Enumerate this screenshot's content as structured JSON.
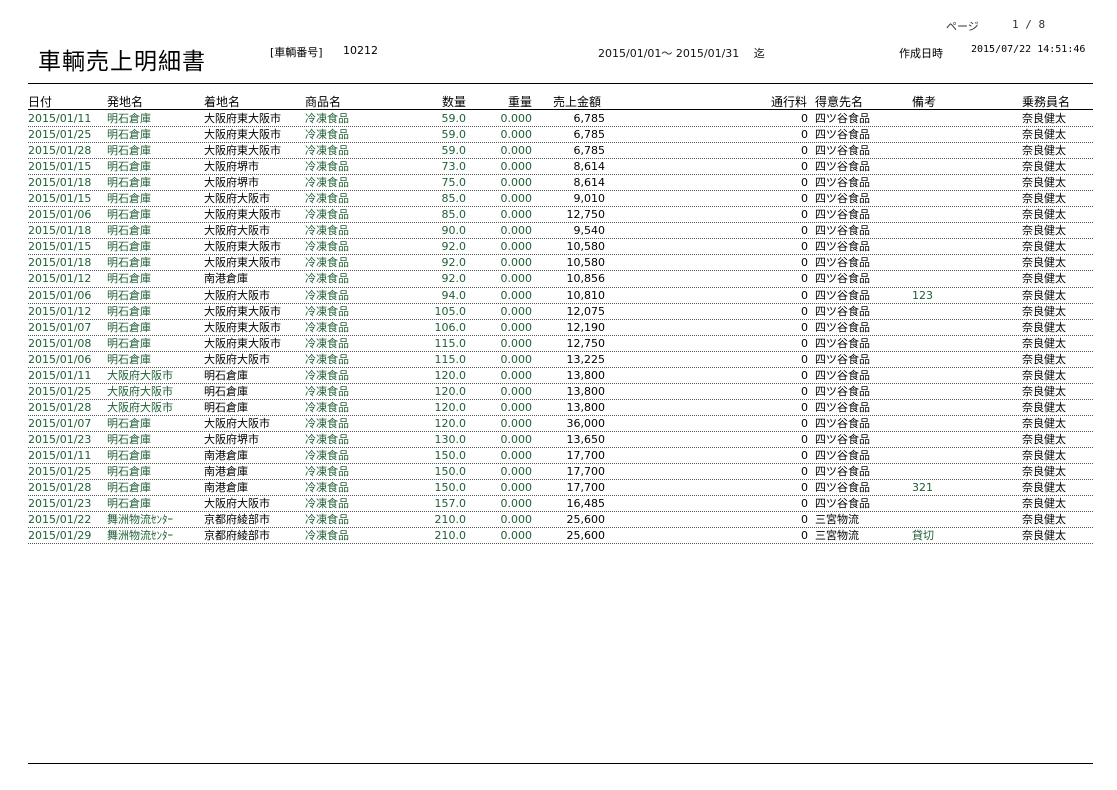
{
  "header": {
    "title": "車輌売上明細書",
    "vehicle_label": "[車輌番号]",
    "vehicle_no": "10212",
    "page_label": "ページ",
    "page_value": "1 / 8",
    "period": "2015/01/01～ 2015/01/31　 迄",
    "created_label": "作成日時",
    "created_value": "2015/07/22  14:51:46"
  },
  "columns": {
    "date": "日付",
    "origin": "発地名",
    "dest": "着地名",
    "product": "商品名",
    "qty": "数量",
    "weight": "重量",
    "sales": "売上金額",
    "toll": "通行料",
    "customer": "得意先名",
    "remarks": "備考",
    "driver": "乗務員名"
  },
  "rows": [
    {
      "date": "2015/01/11",
      "origin": "明石倉庫",
      "dest": "大阪府東大阪市",
      "product": "冷凍食品",
      "qty": "59.0",
      "weight": "0.000",
      "sales": "6,785",
      "toll": "0",
      "customer": "四ツ谷食品",
      "remarks": "",
      "driver": "奈良健太"
    },
    {
      "date": "2015/01/25",
      "origin": "明石倉庫",
      "dest": "大阪府東大阪市",
      "product": "冷凍食品",
      "qty": "59.0",
      "weight": "0.000",
      "sales": "6,785",
      "toll": "0",
      "customer": "四ツ谷食品",
      "remarks": "",
      "driver": "奈良健太"
    },
    {
      "date": "2015/01/28",
      "origin": "明石倉庫",
      "dest": "大阪府東大阪市",
      "product": "冷凍食品",
      "qty": "59.0",
      "weight": "0.000",
      "sales": "6,785",
      "toll": "0",
      "customer": "四ツ谷食品",
      "remarks": "",
      "driver": "奈良健太"
    },
    {
      "date": "2015/01/15",
      "origin": "明石倉庫",
      "dest": "大阪府堺市",
      "product": "冷凍食品",
      "qty": "73.0",
      "weight": "0.000",
      "sales": "8,614",
      "toll": "0",
      "customer": "四ツ谷食品",
      "remarks": "",
      "driver": "奈良健太"
    },
    {
      "date": "2015/01/18",
      "origin": "明石倉庫",
      "dest": "大阪府堺市",
      "product": "冷凍食品",
      "qty": "75.0",
      "weight": "0.000",
      "sales": "8,614",
      "toll": "0",
      "customer": "四ツ谷食品",
      "remarks": "",
      "driver": "奈良健太"
    },
    {
      "date": "2015/01/15",
      "origin": "明石倉庫",
      "dest": "大阪府大阪市",
      "product": "冷凍食品",
      "qty": "85.0",
      "weight": "0.000",
      "sales": "9,010",
      "toll": "0",
      "customer": "四ツ谷食品",
      "remarks": "",
      "driver": "奈良健太"
    },
    {
      "date": "2015/01/06",
      "origin": "明石倉庫",
      "dest": "大阪府東大阪市",
      "product": "冷凍食品",
      "qty": "85.0",
      "weight": "0.000",
      "sales": "12,750",
      "toll": "0",
      "customer": "四ツ谷食品",
      "remarks": "",
      "driver": "奈良健太"
    },
    {
      "date": "2015/01/18",
      "origin": "明石倉庫",
      "dest": "大阪府大阪市",
      "product": "冷凍食品",
      "qty": "90.0",
      "weight": "0.000",
      "sales": "9,540",
      "toll": "0",
      "customer": "四ツ谷食品",
      "remarks": "",
      "driver": "奈良健太"
    },
    {
      "date": "2015/01/15",
      "origin": "明石倉庫",
      "dest": "大阪府東大阪市",
      "product": "冷凍食品",
      "qty": "92.0",
      "weight": "0.000",
      "sales": "10,580",
      "toll": "0",
      "customer": "四ツ谷食品",
      "remarks": "",
      "driver": "奈良健太"
    },
    {
      "date": "2015/01/18",
      "origin": "明石倉庫",
      "dest": "大阪府東大阪市",
      "product": "冷凍食品",
      "qty": "92.0",
      "weight": "0.000",
      "sales": "10,580",
      "toll": "0",
      "customer": "四ツ谷食品",
      "remarks": "",
      "driver": "奈良健太"
    },
    {
      "date": "2015/01/12",
      "origin": "明石倉庫",
      "dest": "南港倉庫",
      "product": "冷凍食品",
      "qty": "92.0",
      "weight": "0.000",
      "sales": "10,856",
      "toll": "0",
      "customer": "四ツ谷食品",
      "remarks": "",
      "driver": "奈良健太"
    },
    {
      "date": "2015/01/06",
      "origin": "明石倉庫",
      "dest": "大阪府大阪市",
      "product": "冷凍食品",
      "qty": "94.0",
      "weight": "0.000",
      "sales": "10,810",
      "toll": "0",
      "customer": "四ツ谷食品",
      "remarks": "123",
      "driver": "奈良健太"
    },
    {
      "date": "2015/01/12",
      "origin": "明石倉庫",
      "dest": "大阪府東大阪市",
      "product": "冷凍食品",
      "qty": "105.0",
      "weight": "0.000",
      "sales": "12,075",
      "toll": "0",
      "customer": "四ツ谷食品",
      "remarks": "",
      "driver": "奈良健太"
    },
    {
      "date": "2015/01/07",
      "origin": "明石倉庫",
      "dest": "大阪府東大阪市",
      "product": "冷凍食品",
      "qty": "106.0",
      "weight": "0.000",
      "sales": "12,190",
      "toll": "0",
      "customer": "四ツ谷食品",
      "remarks": "",
      "driver": "奈良健太"
    },
    {
      "date": "2015/01/08",
      "origin": "明石倉庫",
      "dest": "大阪府東大阪市",
      "product": "冷凍食品",
      "qty": "115.0",
      "weight": "0.000",
      "sales": "12,750",
      "toll": "0",
      "customer": "四ツ谷食品",
      "remarks": "",
      "driver": "奈良健太"
    },
    {
      "date": "2015/01/06",
      "origin": "明石倉庫",
      "dest": "大阪府大阪市",
      "product": "冷凍食品",
      "qty": "115.0",
      "weight": "0.000",
      "sales": "13,225",
      "toll": "0",
      "customer": "四ツ谷食品",
      "remarks": "",
      "driver": "奈良健太"
    },
    {
      "date": "2015/01/11",
      "origin": "大阪府大阪市",
      "dest": "明石倉庫",
      "product": "冷凍食品",
      "qty": "120.0",
      "weight": "0.000",
      "sales": "13,800",
      "toll": "0",
      "customer": "四ツ谷食品",
      "remarks": "",
      "driver": "奈良健太"
    },
    {
      "date": "2015/01/25",
      "origin": "大阪府大阪市",
      "dest": "明石倉庫",
      "product": "冷凍食品",
      "qty": "120.0",
      "weight": "0.000",
      "sales": "13,800",
      "toll": "0",
      "customer": "四ツ谷食品",
      "remarks": "",
      "driver": "奈良健太"
    },
    {
      "date": "2015/01/28",
      "origin": "大阪府大阪市",
      "dest": "明石倉庫",
      "product": "冷凍食品",
      "qty": "120.0",
      "weight": "0.000",
      "sales": "13,800",
      "toll": "0",
      "customer": "四ツ谷食品",
      "remarks": "",
      "driver": "奈良健太"
    },
    {
      "date": "2015/01/07",
      "origin": "明石倉庫",
      "dest": "大阪府大阪市",
      "product": "冷凍食品",
      "qty": "120.0",
      "weight": "0.000",
      "sales": "36,000",
      "toll": "0",
      "customer": "四ツ谷食品",
      "remarks": "",
      "driver": "奈良健太"
    },
    {
      "date": "2015/01/23",
      "origin": "明石倉庫",
      "dest": "大阪府堺市",
      "product": "冷凍食品",
      "qty": "130.0",
      "weight": "0.000",
      "sales": "13,650",
      "toll": "0",
      "customer": "四ツ谷食品",
      "remarks": "",
      "driver": "奈良健太"
    },
    {
      "date": "2015/01/11",
      "origin": "明石倉庫",
      "dest": "南港倉庫",
      "product": "冷凍食品",
      "qty": "150.0",
      "weight": "0.000",
      "sales": "17,700",
      "toll": "0",
      "customer": "四ツ谷食品",
      "remarks": "",
      "driver": "奈良健太"
    },
    {
      "date": "2015/01/25",
      "origin": "明石倉庫",
      "dest": "南港倉庫",
      "product": "冷凍食品",
      "qty": "150.0",
      "weight": "0.000",
      "sales": "17,700",
      "toll": "0",
      "customer": "四ツ谷食品",
      "remarks": "",
      "driver": "奈良健太"
    },
    {
      "date": "2015/01/28",
      "origin": "明石倉庫",
      "dest": "南港倉庫",
      "product": "冷凍食品",
      "qty": "150.0",
      "weight": "0.000",
      "sales": "17,700",
      "toll": "0",
      "customer": "四ツ谷食品",
      "remarks": "321",
      "driver": "奈良健太"
    },
    {
      "date": "2015/01/23",
      "origin": "明石倉庫",
      "dest": "大阪府大阪市",
      "product": "冷凍食品",
      "qty": "157.0",
      "weight": "0.000",
      "sales": "16,485",
      "toll": "0",
      "customer": "四ツ谷食品",
      "remarks": "",
      "driver": "奈良健太"
    },
    {
      "date": "2015/01/22",
      "origin": "舞洲物流ｾﾝﾀｰ",
      "dest": "京都府綾部市",
      "product": "冷凍食品",
      "qty": "210.0",
      "weight": "0.000",
      "sales": "25,600",
      "toll": "0",
      "customer": "三宮物流",
      "remarks": "",
      "driver": "奈良健太"
    },
    {
      "date": "2015/01/29",
      "origin": "舞洲物流ｾﾝﾀｰ",
      "dest": "京都府綾部市",
      "product": "冷凍食品",
      "qty": "210.0",
      "weight": "0.000",
      "sales": "25,600",
      "toll": "0",
      "customer": "三宮物流",
      "remarks": "貸切",
      "driver": "奈良健太"
    }
  ]
}
